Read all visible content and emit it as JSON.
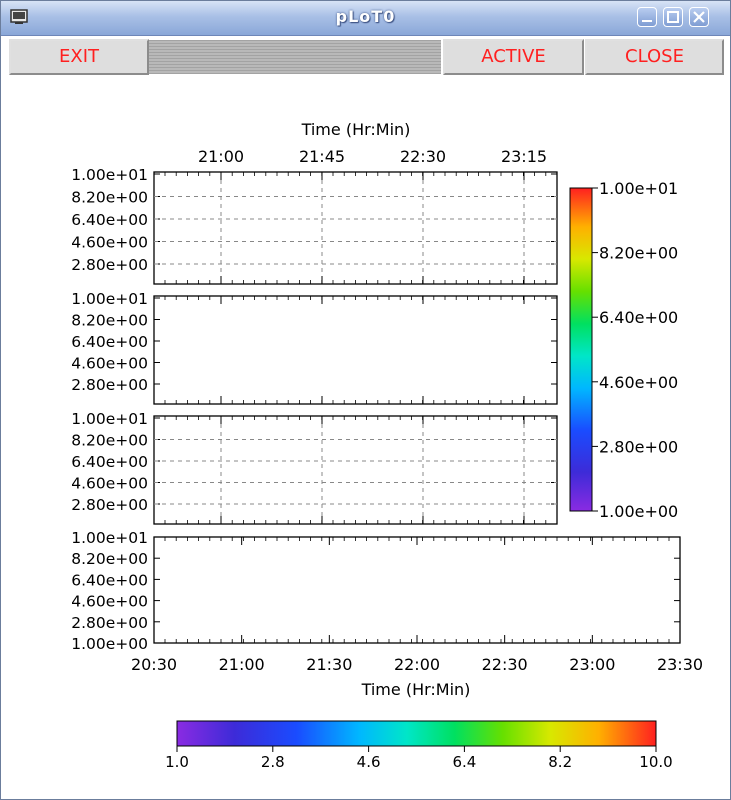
{
  "window": {
    "title": "pLoT0"
  },
  "toolbar": {
    "exit_label": "EXIT",
    "active_label": "ACTIVE",
    "close_label": "CLOSE"
  },
  "top_axis": {
    "label": "Time (Hr:Min)",
    "ticks": [
      "21:00",
      "21:45",
      "22:30",
      "23:15"
    ]
  },
  "bottom_axis": {
    "label": "Time (Hr:Min)",
    "ticks": [
      "20:30",
      "21:00",
      "21:30",
      "22:00",
      "22:30",
      "23:00",
      "23:30"
    ]
  },
  "panel_y_ticks": [
    "1.00e+01",
    "8.20e+00",
    "6.40e+00",
    "4.60e+00",
    "2.80e+00"
  ],
  "bottom_y_ticks": [
    "1.00e+01",
    "8.20e+00",
    "6.40e+00",
    "4.60e+00",
    "2.80e+00",
    "1.00e+00"
  ],
  "colorbar_vertical": {
    "ticks": [
      "1.00e+01",
      "8.20e+00",
      "6.40e+00",
      "4.60e+00",
      "2.80e+00",
      "1.00e+00"
    ]
  },
  "colorbar_horizontal": {
    "ticks": [
      "1.0",
      "2.8",
      "4.6",
      "6.4",
      "8.2",
      "10.0"
    ]
  },
  "chart_data": [
    {
      "type": "heatmap",
      "x_range": [
        "20:45",
        "23:25"
      ],
      "ylim": [
        1.0,
        10.0
      ],
      "grid": true,
      "values": []
    },
    {
      "type": "heatmap",
      "x_range": [
        "20:45",
        "23:25"
      ],
      "ylim": [
        1.0,
        10.0
      ],
      "grid": false,
      "values": []
    },
    {
      "type": "heatmap",
      "x_range": [
        "20:45",
        "23:25"
      ],
      "ylim": [
        1.0,
        10.0
      ],
      "grid": true,
      "values": []
    },
    {
      "type": "heatmap",
      "xlabel": "Time (Hr:Min)",
      "x_range": [
        "20:30",
        "23:30"
      ],
      "ylim": [
        1.0,
        10.0
      ],
      "grid": false,
      "values": []
    }
  ],
  "colors": {
    "tick_text": "#000000",
    "button_text": "#ff2020",
    "grid": "#888888"
  }
}
